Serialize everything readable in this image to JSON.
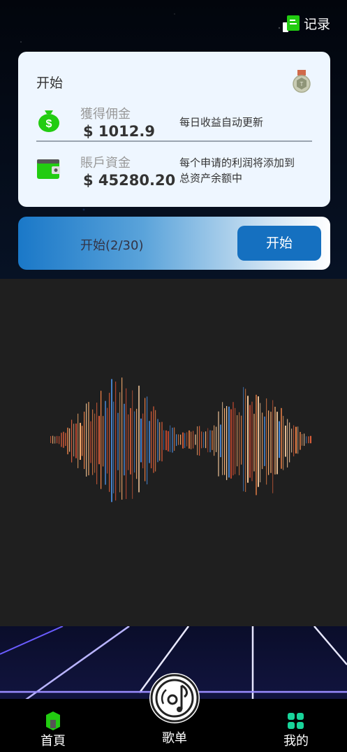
{
  "header": {
    "records_label": "记录"
  },
  "earnings_card": {
    "title": "开始",
    "commission": {
      "label": "獲得佣金",
      "amount": "$ 1012.9",
      "note": "每日收益自动更新"
    },
    "account_funds": {
      "label": "賬戶資金",
      "amount": "$ 45280.20",
      "note_line1": "每个申请的利润将添加到",
      "note_line2": "总资产余额中"
    }
  },
  "start_bar": {
    "progress_text": "开始(2/30)",
    "button_label": "开始"
  },
  "bottom_nav": {
    "home_label": "首頁",
    "playlist_label": "歌单",
    "mine_label": "我的"
  },
  "colors": {
    "accent_blue": "#1570c0",
    "icon_green": "#22cc11",
    "card_bg": "#eef6ff"
  },
  "icons": {
    "records": "document-icon",
    "badge": "medal-badge-icon",
    "commission": "money-bag-icon",
    "account": "wallet-icon",
    "home": "home-icon",
    "playlist": "vinyl-music-icon",
    "mine": "grid-apps-icon"
  }
}
